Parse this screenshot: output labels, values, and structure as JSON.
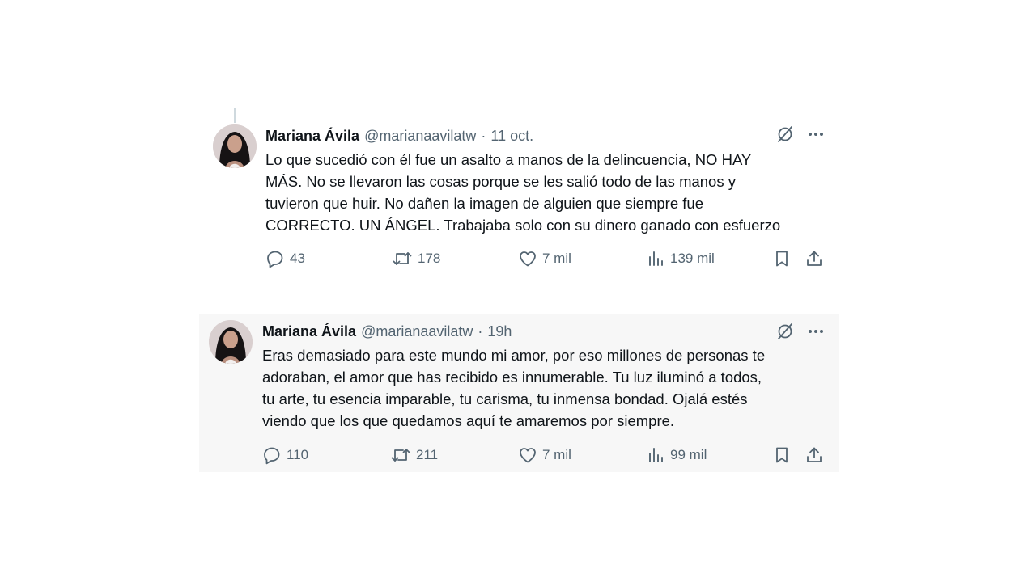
{
  "tweets": [
    {
      "author_name": "Mariana Ávila",
      "handle": "@marianaavilatw",
      "separator": "·",
      "time": "11 oct.",
      "text": "Lo que sucedió con él fue un asalto a manos de la delincuencia, NO HAY\nMÁS. No se llevaron las cosas porque se les salió todo de las manos y\ntuvieron que huir. No dañen la imagen de alguien que siempre fue\nCORRECTO. UN ÁNGEL. Trabajaba solo con su dinero ganado con esfuerzo",
      "replies": "43",
      "retweets": "178",
      "likes": "7 mil",
      "views": "139 mil"
    },
    {
      "author_name": "Mariana Ávila",
      "handle": "@marianaavilatw",
      "separator": "·",
      "time": "19h",
      "text": "Eras demasiado para este mundo mi amor, por eso millones de personas te\nadoraban, el amor que has recibido es innumerable. Tu luz iluminó a todos,\ntu arte, tu esencia imparable, tu carisma, tu inmensa bondad. Ojalá estés\nviendo que los que quedamos aquí te amaremos por siempre.",
      "replies": "110",
      "retweets": "211",
      "likes": "7 mil",
      "views": "99 mil"
    }
  ],
  "icons": {
    "grok": "grok-icon",
    "more": "more-icon",
    "reply": "reply-icon",
    "retweet": "retweet-icon",
    "like": "heart-icon",
    "views": "views-icon",
    "bookmark": "bookmark-icon",
    "share": "share-icon"
  },
  "colors": {
    "text": "#0f1419",
    "secondary": "#536471",
    "highlight_bg": "#f7f7f7"
  }
}
